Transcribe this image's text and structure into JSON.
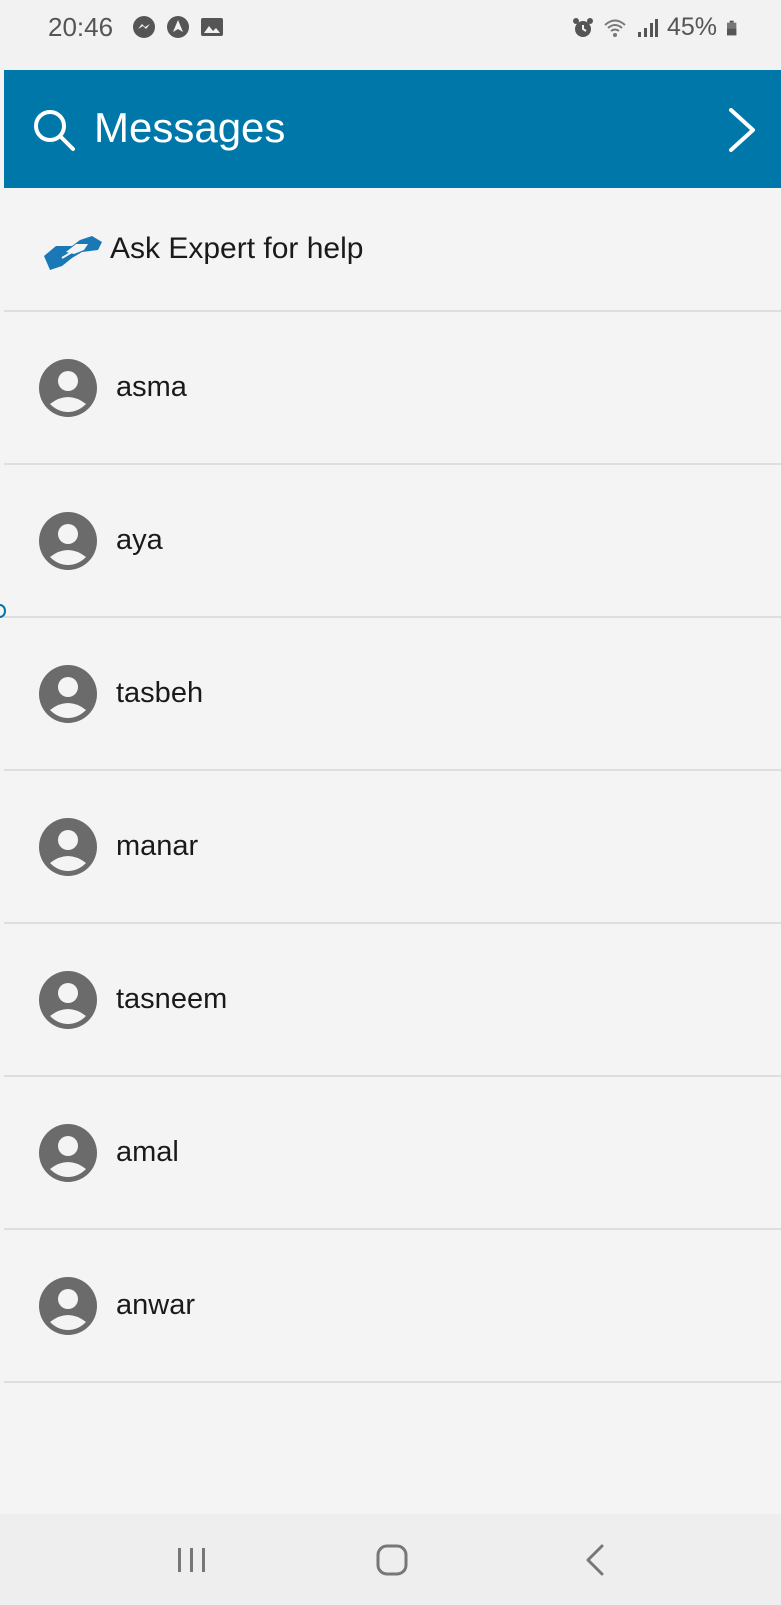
{
  "status_bar": {
    "time": "20:46",
    "battery": "45%",
    "left_icons": [
      "messenger-icon",
      "navigation-app-icon",
      "gallery-icon"
    ],
    "right_icons": [
      "alarm-icon",
      "wifi-icon",
      "signal-icon",
      "battery-icon"
    ]
  },
  "app_bar": {
    "title": "Messages",
    "color": "#0077a9"
  },
  "ask_expert": {
    "label": "Ask Expert for help",
    "icon": "handshake-icon"
  },
  "contacts": [
    {
      "name": "asma"
    },
    {
      "name": "aya"
    },
    {
      "name": "tasbeh"
    },
    {
      "name": "manar"
    },
    {
      "name": "tasneem"
    },
    {
      "name": "amal"
    },
    {
      "name": "anwar"
    }
  ],
  "nav_bar": {
    "buttons": [
      "recents-icon",
      "home-icon",
      "back-icon"
    ]
  }
}
